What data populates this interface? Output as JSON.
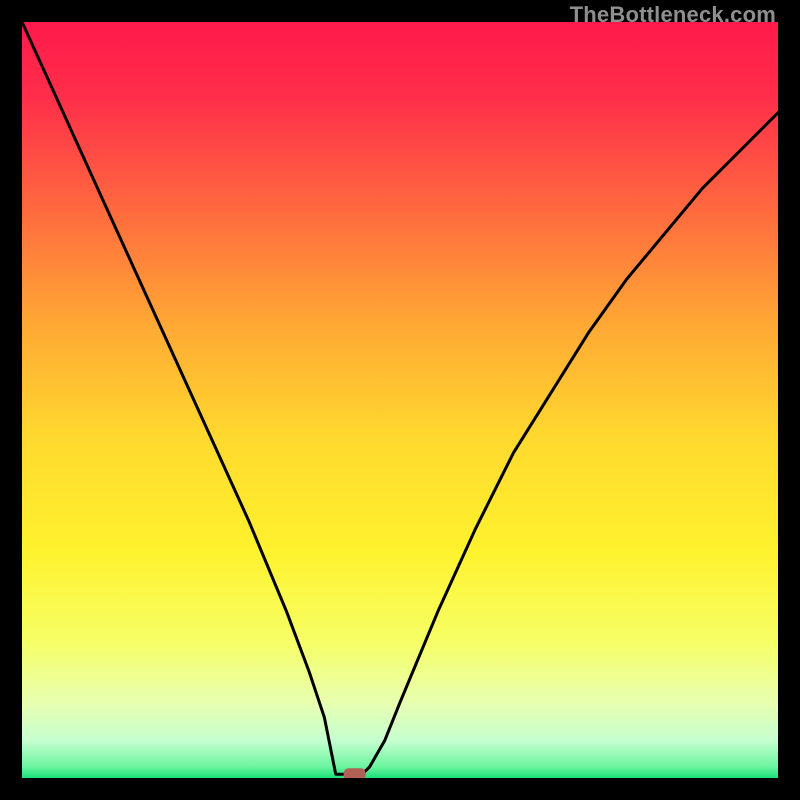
{
  "watermark": "TheBottleneck.com",
  "chart_data": {
    "type": "line",
    "title": "",
    "xlabel": "",
    "ylabel": "",
    "xlim": [
      0,
      100
    ],
    "ylim": [
      0,
      100
    ],
    "series": [
      {
        "name": "curve",
        "x": [
          0,
          5,
          10,
          15,
          20,
          25,
          30,
          35,
          38,
          40,
          41.5,
          43,
          44,
          45,
          46,
          48,
          50,
          55,
          60,
          65,
          70,
          75,
          80,
          85,
          90,
          95,
          100
        ],
        "y": [
          100,
          89,
          78,
          67,
          56,
          45,
          34,
          22,
          14,
          8,
          3,
          0.5,
          0.5,
          0.5,
          1.5,
          5,
          10,
          22,
          33,
          43,
          51,
          59,
          66,
          72,
          78,
          83,
          88
        ]
      }
    ],
    "flat_bottom": {
      "x0": 41.5,
      "x1": 45.5,
      "y": 0.5
    },
    "marker": {
      "x": 44,
      "y": 0.5,
      "color": "#b06055"
    },
    "gradient_stops": [
      {
        "offset": 0.0,
        "color": "#ff1a4b"
      },
      {
        "offset": 0.1,
        "color": "#ff2e4a"
      },
      {
        "offset": 0.25,
        "color": "#ff6a3f"
      },
      {
        "offset": 0.4,
        "color": "#ffa834"
      },
      {
        "offset": 0.55,
        "color": "#ffd92e"
      },
      {
        "offset": 0.7,
        "color": "#fff22e"
      },
      {
        "offset": 0.82,
        "color": "#f6ff66"
      },
      {
        "offset": 0.9,
        "color": "#e8ffb0"
      },
      {
        "offset": 0.95,
        "color": "#c6ffd0"
      },
      {
        "offset": 0.985,
        "color": "#6cf5a0"
      },
      {
        "offset": 1.0,
        "color": "#18e07a"
      }
    ]
  }
}
